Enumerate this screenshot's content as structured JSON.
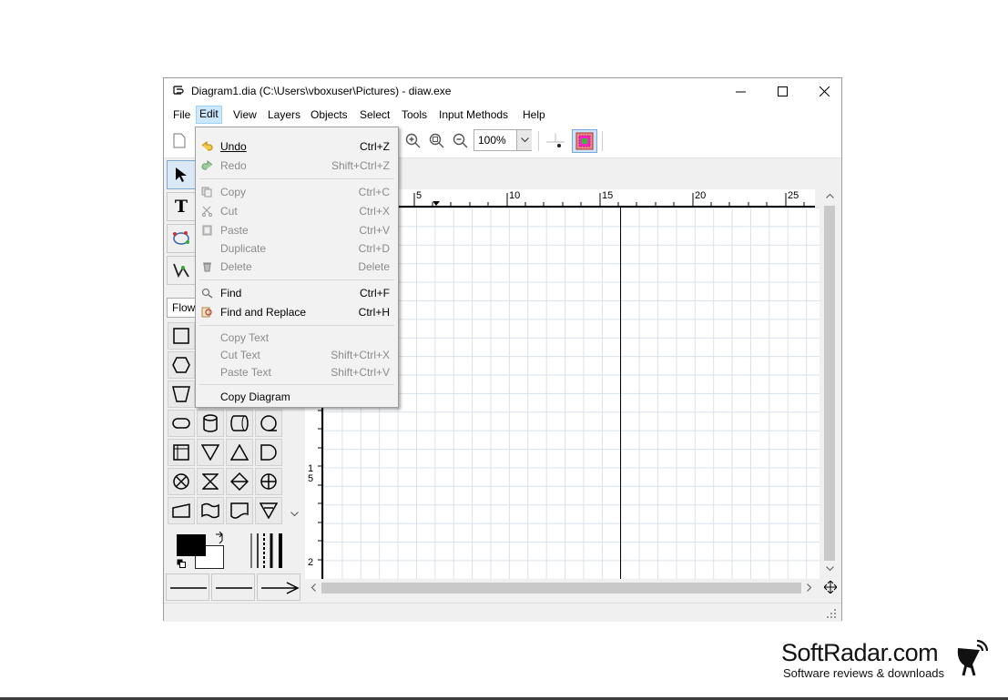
{
  "window": {
    "title": "Diagram1.dia (C:\\Users\\vboxuser\\Pictures) - diaw.exe"
  },
  "menubar": {
    "items": [
      "File",
      "Edit",
      "View",
      "Layers",
      "Objects",
      "Select",
      "Tools",
      "Input Methods",
      "Help"
    ],
    "active": "Edit"
  },
  "toolbar": {
    "zoom_value": "100%"
  },
  "toolbox": {
    "sheet_label": "Flow"
  },
  "ruler": {
    "h_labels": [
      "5",
      "10",
      "15",
      "20",
      "25"
    ],
    "v_labels": [
      "1",
      "5",
      "2"
    ]
  },
  "edit_menu": {
    "items": [
      {
        "label": "Undo",
        "accel": "Ctrl+Z",
        "enabled": true,
        "icon": "undo-icon"
      },
      {
        "label": "Redo",
        "accel": "Shift+Ctrl+Z",
        "enabled": false,
        "icon": "redo-icon"
      },
      {
        "label": "Copy",
        "accel": "Ctrl+C",
        "enabled": false,
        "icon": "copy-icon"
      },
      {
        "label": "Cut",
        "accel": "Ctrl+X",
        "enabled": false,
        "icon": "cut-icon"
      },
      {
        "label": "Paste",
        "accel": "Ctrl+V",
        "enabled": false,
        "icon": "paste-icon"
      },
      {
        "label": "Duplicate",
        "accel": "Ctrl+D",
        "enabled": false,
        "icon": ""
      },
      {
        "label": "Delete",
        "accel": "Delete",
        "enabled": false,
        "icon": "delete-icon"
      },
      {
        "label": "Find",
        "accel": "Ctrl+F",
        "enabled": true,
        "icon": "find-icon"
      },
      {
        "label": "Find and Replace",
        "accel": "Ctrl+H",
        "enabled": true,
        "icon": "find-replace-icon"
      },
      {
        "label": "Copy Text",
        "accel": "",
        "enabled": false,
        "icon": ""
      },
      {
        "label": "Cut Text",
        "accel": "Shift+Ctrl+X",
        "enabled": false,
        "icon": ""
      },
      {
        "label": "Paste Text",
        "accel": "Shift+Ctrl+V",
        "enabled": false,
        "icon": ""
      },
      {
        "label": "Copy Diagram",
        "accel": "",
        "enabled": true,
        "icon": ""
      }
    ]
  },
  "watermark": {
    "title": "SoftRadar.com",
    "subtitle": "Software reviews & downloads"
  }
}
